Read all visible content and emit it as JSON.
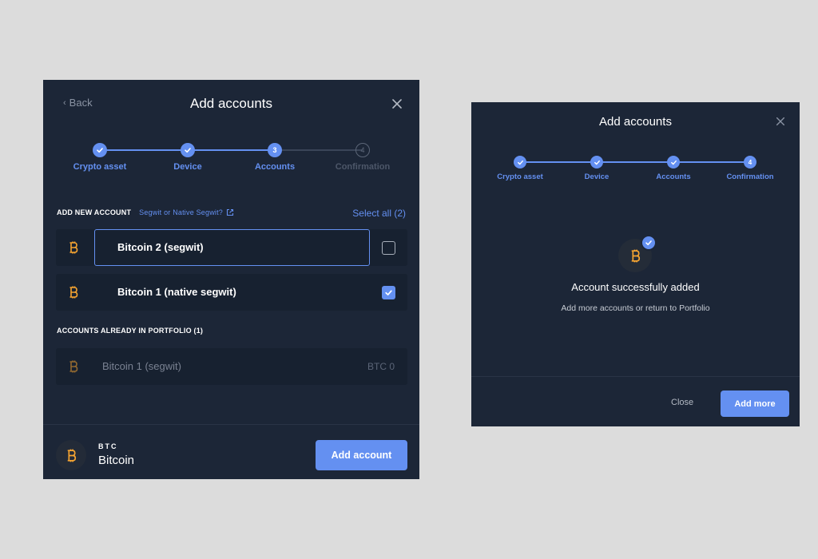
{
  "left_dialog": {
    "back_label": "Back",
    "title": "Add accounts",
    "steps": [
      {
        "label": "Crypto asset",
        "state": "done",
        "number": ""
      },
      {
        "label": "Device",
        "state": "done",
        "number": ""
      },
      {
        "label": "Accounts",
        "state": "active",
        "number": "3"
      },
      {
        "label": "Confirmation",
        "state": "pending",
        "number": "4"
      }
    ],
    "new_section_title": "ADD NEW ACCOUNT",
    "segwit_link": "Segwit or Native Segwit?",
    "select_all": "Select all (2)",
    "new_accounts": [
      {
        "name": "Bitcoin 2 (segwit)",
        "checked": false
      },
      {
        "name": "Bitcoin 1 (native segwit)",
        "checked": true
      }
    ],
    "existing_section_title": "ACCOUNTS ALREADY IN PORTFOLIO (1)",
    "existing_accounts": [
      {
        "name": "Bitcoin 1 (segwit)",
        "balance": "BTC 0"
      }
    ],
    "footer": {
      "ticker": "BTC",
      "asset_name": "Bitcoin",
      "primary_button": "Add account"
    }
  },
  "right_dialog": {
    "title": "Add accounts",
    "steps": [
      {
        "label": "Crypto asset",
        "state": "done",
        "number": ""
      },
      {
        "label": "Device",
        "state": "done",
        "number": ""
      },
      {
        "label": "Accounts",
        "state": "done",
        "number": ""
      },
      {
        "label": "Confirmation",
        "state": "active",
        "number": "4"
      }
    ],
    "success_title": "Account successfully added",
    "success_subtitle": "Add more accounts or return to Portfolio",
    "close_button": "Close",
    "primary_button": "Add more"
  },
  "colors": {
    "background": "#dcdcdc",
    "panel": "#1c2637",
    "accent": "#6490f1",
    "bitcoin": "#f7a531"
  },
  "icons": [
    "chevron-left-icon",
    "close-icon",
    "check-icon",
    "external-link-icon",
    "bitcoin-icon"
  ]
}
